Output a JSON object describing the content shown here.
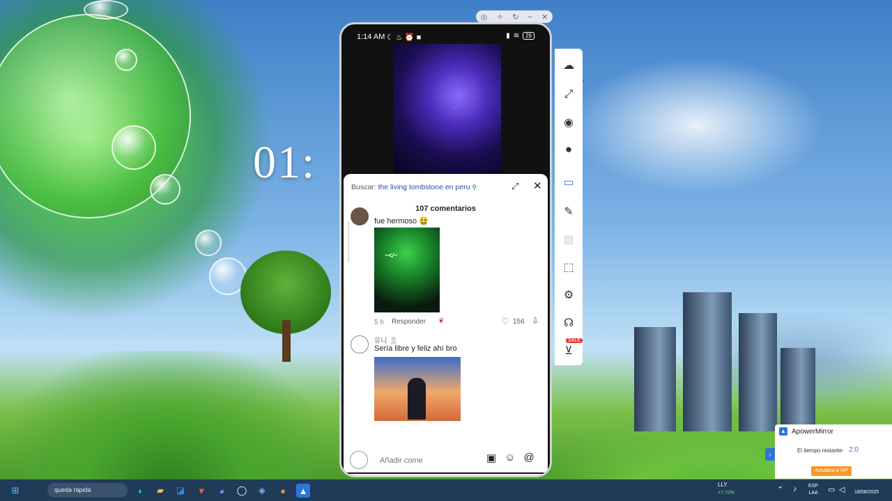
{
  "desktop": {
    "clock_partial": "01:"
  },
  "phone": {
    "status": {
      "time": "1:14 AM",
      "battery": "29"
    },
    "comments": {
      "search_label": "Buscar:",
      "search_query": "the living tombstone en peru",
      "count_label": "107 comentarios",
      "items": [
        {
          "text": "fue hermoso 🤮",
          "time": "5 h",
          "reply_label": "Responder",
          "likes": "156"
        },
        {
          "user": "유니 🎗",
          "text": "Sería libre y feliz ahí bro"
        }
      ],
      "input_placeholder": "Añadir come"
    }
  },
  "watermark": "ApowerMirror",
  "promo": {
    "title": "ApowerMirror",
    "time_label": "El tiempo restante:",
    "time_value": "2:0",
    "cta": "Actualiza a VIP"
  },
  "side_toolbar": {
    "sale_badge": "SALE"
  },
  "taskbar": {
    "search_text": "queda rápida",
    "ticker_name": "LLY",
    "ticker_change": "+7.70%",
    "lang_top": "ESP",
    "lang_bottom": "LAA",
    "date": "18/08/2025"
  },
  "icons": [
    "windows-start-icon",
    "search-icon",
    "edge-icon",
    "folder-icon",
    "outlook-icon",
    "brave-icon",
    "discord-icon",
    "github-icon",
    "vpn-icon",
    "firefox-icon",
    "apowermirror-icon"
  ]
}
